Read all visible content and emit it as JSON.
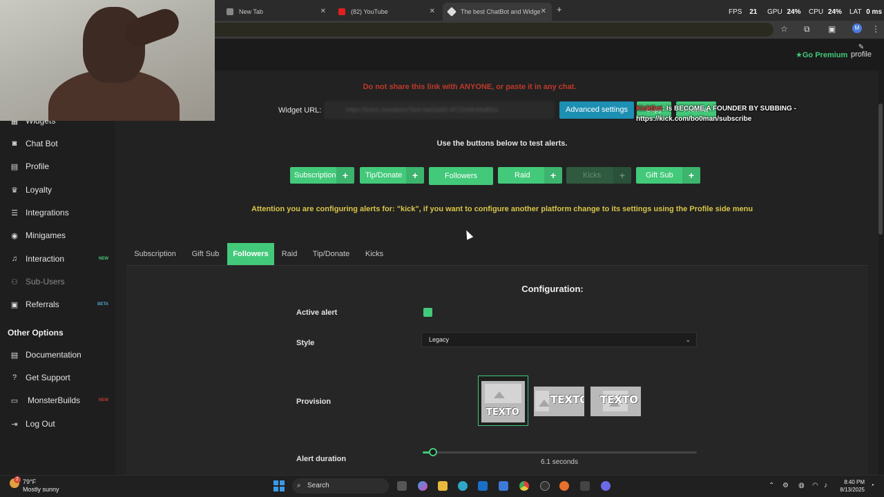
{
  "browser": {
    "tabs": [
      {
        "title": "New Tab"
      },
      {
        "title": "(82) YouTube"
      },
      {
        "title": "The best ChatBot and Widgets"
      }
    ],
    "new_tab_symbol": "+",
    "close_symbol": "✕"
  },
  "stats": {
    "fps_label": "FPS",
    "fps_value": "21",
    "gpu_label": "GPU",
    "gpu_value": "24",
    "cpu_label": "CPU",
    "cpu_value": "24",
    "lat_label": "LAT",
    "lat_value": "0",
    "unit": "ms",
    "pct": "%"
  },
  "header": {
    "premium_label": "Go Premium",
    "profile_label": "profile"
  },
  "sidebar": {
    "items": [
      {
        "label": "Widgets",
        "icon": "widgets-icon"
      },
      {
        "label": "Chat Bot",
        "icon": "robot-icon"
      },
      {
        "label": "Profile",
        "icon": "id-card-icon"
      },
      {
        "label": "Loyalty",
        "icon": "trophy-icon"
      },
      {
        "label": "Integrations",
        "icon": "list-icon"
      },
      {
        "label": "Minigames",
        "icon": "gamepad-icon"
      },
      {
        "label": "Interaction",
        "icon": "music-icon",
        "badge": "NEW"
      },
      {
        "label": "Sub-Users",
        "icon": "users-icon"
      },
      {
        "label": "Referrals",
        "icon": "user-tie-icon",
        "badge": "BETA"
      }
    ],
    "other_heading": "Other Options",
    "other_items": [
      {
        "label": "Documentation",
        "icon": "document-icon"
      },
      {
        "label": "Get Support",
        "icon": "question-icon"
      },
      {
        "label": "MonsterBuilds",
        "icon": "laptop-icon",
        "badge": "NEW"
      },
      {
        "label": "Log Out",
        "icon": "logout-icon"
      }
    ]
  },
  "main": {
    "warning": "Do not share this link with ANYONE, or paste it in any chat.",
    "widget_url_label": "Widget URL:",
    "widget_url_value": "https://botrix.live/alerts?bid=9a61b55-4f722d4b49a8f2a",
    "advanced_settings_label": "Advanced settings",
    "copy_label": "Copy",
    "preview_label": "Preview",
    "chat_overlay": {
      "user": "KickBot",
      "text": ": Is BECOME A FOUNDER BY SUBBING -",
      "link": "https://kick.com/bo0man/subscribe"
    },
    "test_hint": "Use the buttons below to test alerts.",
    "alert_buttons": [
      {
        "label": "Subscription"
      },
      {
        "label": "Tip/Donate"
      },
      {
        "label": "Followers"
      },
      {
        "label": "Raid"
      },
      {
        "label": "Kicks"
      },
      {
        "label": "Gift Sub"
      }
    ],
    "plus_symbol": "+",
    "attention": "Attention you are configuring alerts for: \"kick\", if you want to configure another platform change to its settings using the Profile side menu",
    "tabs": [
      {
        "label": "Subscription"
      },
      {
        "label": "Gift Sub"
      },
      {
        "label": "Followers",
        "active": true
      },
      {
        "label": "Raid"
      },
      {
        "label": "Tip/Donate"
      },
      {
        "label": "Kicks"
      }
    ],
    "config": {
      "title": "Configuration:",
      "active_alert_label": "Active alert",
      "active_alert_checked": true,
      "style_label": "Style",
      "style_value": "Legacy",
      "provision_label": "Provision",
      "provision_text": "TEXTO",
      "provision_selected": 0,
      "alert_duration_label": "Alert duration",
      "alert_duration_value": "6.1 seconds",
      "alert_duration_fraction": 0.04
    }
  },
  "taskbar": {
    "weather_badge": "2",
    "temperature": "79°F",
    "condition": "Mostly sunny",
    "search_label": "Search",
    "time": "8:40 PM",
    "date": "8/13/2025"
  },
  "colors": {
    "accent": "#43c97a",
    "info": "#1c8fb3",
    "danger": "#c0392b",
    "attention": "#d9c54a"
  }
}
